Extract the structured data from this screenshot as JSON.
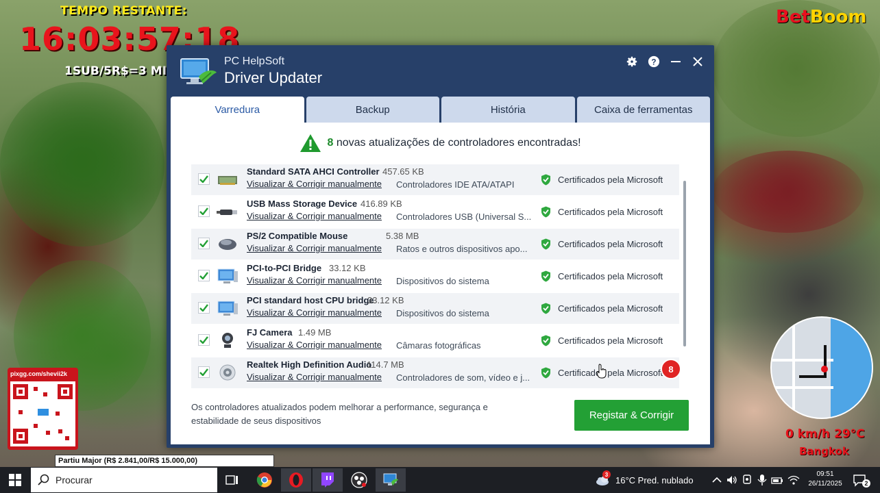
{
  "stream_overlay": {
    "timer_label": "TEMPO RESTANTE:",
    "timer": "16:03:57:18",
    "sub_rate": "1SUB/5R$=3 MI",
    "brand_part1": "Bet",
    "brand_part2": "Boom",
    "qr_url": "pixgg.com/shevii2k",
    "goal_text": "Partiu Major (R$ 2.841,00/R$ 15.000,00)",
    "speed_temp": "0 km/h  29°C",
    "city": "Bangkok"
  },
  "app": {
    "company": "PC HelpSoft",
    "title": "Driver Updater",
    "tabs": [
      "Varredura",
      "Backup",
      "História",
      "Caixa de ferramentas"
    ],
    "active_tab": 0,
    "banner": {
      "count": "8",
      "message": "novas atualizações de controladores encontradas!"
    },
    "drivers": [
      {
        "name": "Standard SATA AHCI Controller",
        "size": "457.65 KB",
        "link": "Visualizar & Corrigir manualmente",
        "category": "Controladores IDE ATA/ATAPI",
        "cert": "Certificados pela Microsoft",
        "icon": "sata-controller-icon"
      },
      {
        "name": "USB Mass Storage Device",
        "size": "416.89 KB",
        "link": "Visualizar & Corrigir manualmente",
        "category": "Controladores USB (Universal S...",
        "cert": "Certificados pela Microsoft",
        "icon": "usb-drive-icon"
      },
      {
        "name": "PS/2 Compatible Mouse",
        "size": "5.38 MB",
        "link": "Visualizar & Corrigir manualmente",
        "category": "Ratos e outros dispositivos apo...",
        "cert": "Certificados pela Microsoft",
        "icon": "mouse-icon"
      },
      {
        "name": "PCI-to-PCI Bridge",
        "size": "33.12 KB",
        "link": "Visualizar & Corrigir manualmente",
        "category": "Dispositivos do sistema",
        "cert": "Certificados pela Microsoft",
        "icon": "computer-icon"
      },
      {
        "name": "PCI standard host CPU bridge",
        "size": "33.12 KB",
        "link": "Visualizar & Corrigir manualmente",
        "category": "Dispositivos do sistema",
        "cert": "Certificados pela Microsoft",
        "icon": "computer-icon"
      },
      {
        "name": "FJ Camera",
        "size": "1.49 MB",
        "link": "Visualizar & Corrigir manualmente",
        "category": "Câmaras fotográficas",
        "cert": "Certificados pela Microsoft",
        "icon": "webcam-icon"
      },
      {
        "name": "Realtek High Definition Audio",
        "size": "114.7 MB",
        "link": "Visualizar & Corrigir manualmente",
        "category": "Controladores de som, vídeo e j...",
        "cert": "Certificados pela Microsoft",
        "icon": "speaker-icon"
      }
    ],
    "footer_note": "Os controladores atualizados podem melhorar a performance, segurança e estabilidade de seus dispositivos",
    "fix_button": "Registar & Corrigir",
    "fix_badge": "8"
  },
  "taskbar": {
    "search_placeholder": "Procurar",
    "weather_badge": "3",
    "weather": "16°C  Pred. nublado",
    "time": "09:51",
    "date": "26/11/2025",
    "notification_count": "2"
  },
  "colors": {
    "window_bg": "#274069",
    "tab_active_text": "#2b5aa5",
    "accent_green": "#23a035",
    "badge_red": "#e02424",
    "overlay_red": "#e8141c",
    "overlay_yellow": "#ffeb1a"
  }
}
